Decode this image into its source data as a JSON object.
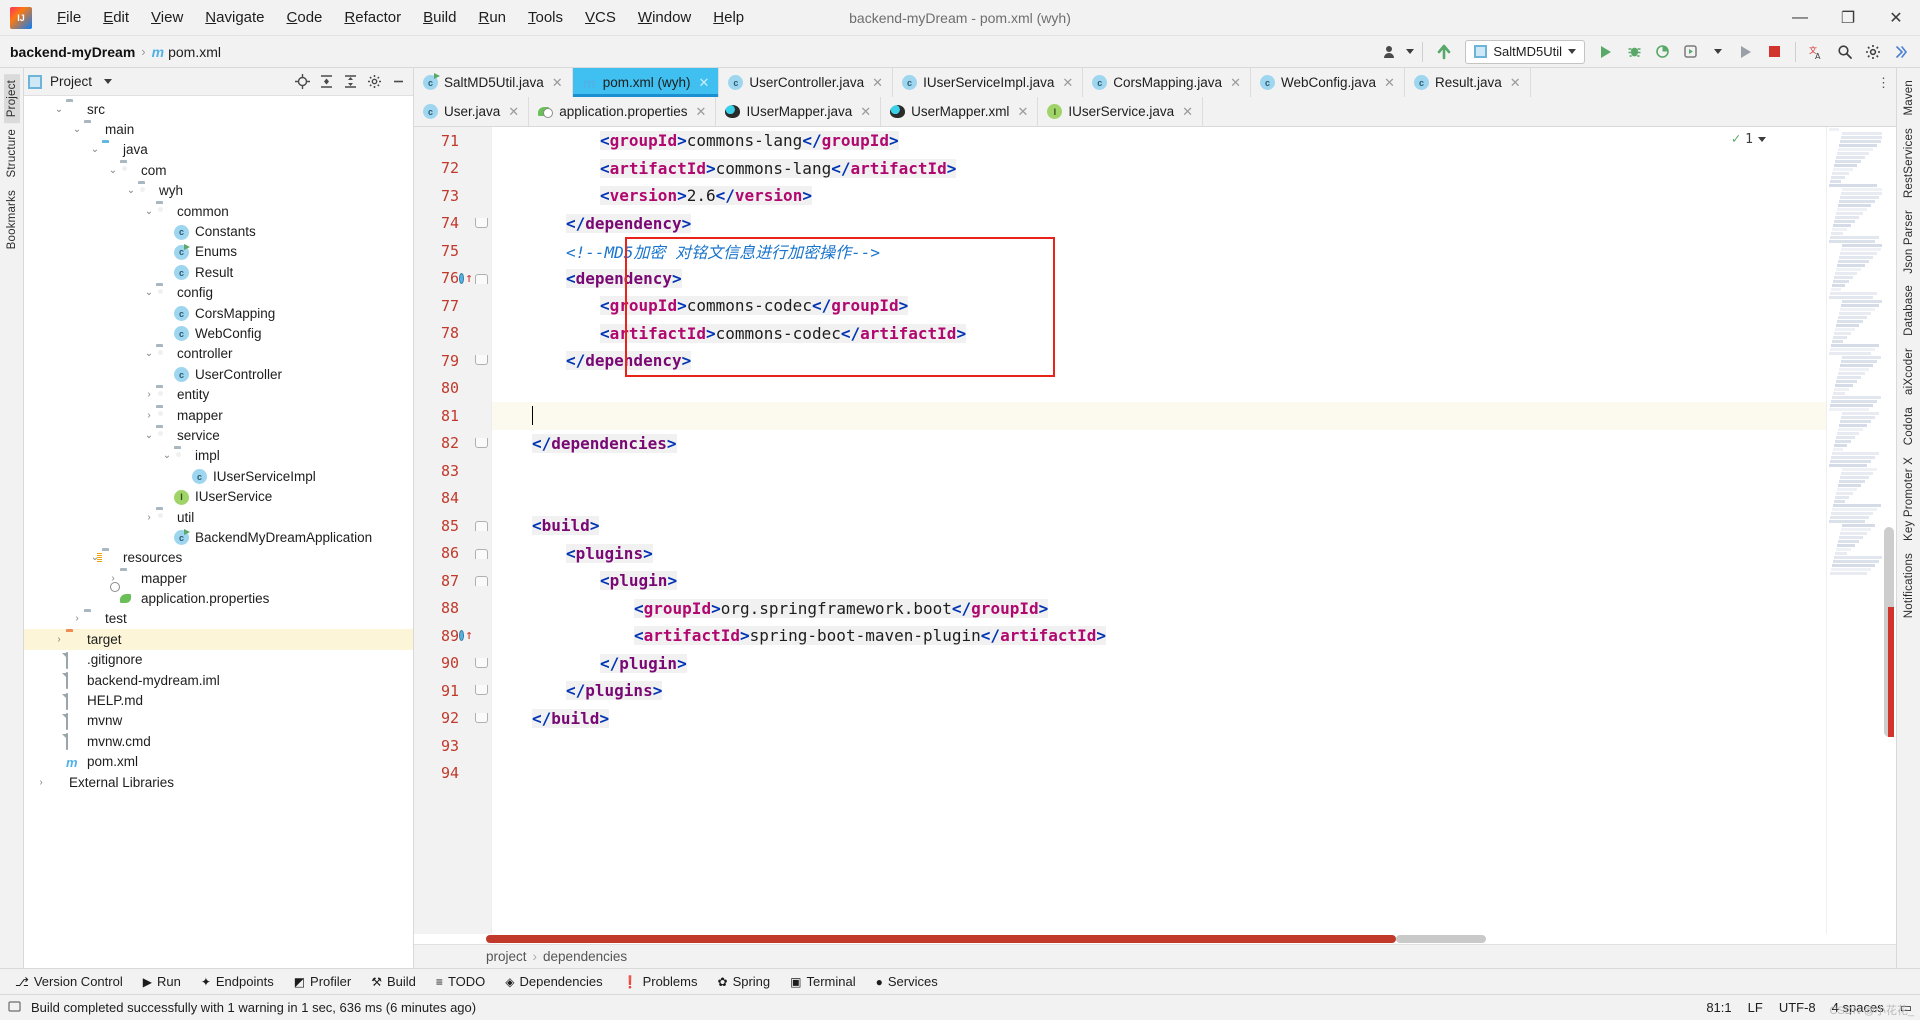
{
  "window": {
    "title": "backend-myDream - pom.xml (wyh)",
    "minimize": "—",
    "maximize": "❐",
    "close": "✕"
  },
  "menu": {
    "items": [
      "File",
      "Edit",
      "View",
      "Navigate",
      "Code",
      "Refactor",
      "Build",
      "Run",
      "Tools",
      "VCS",
      "Window",
      "Help"
    ]
  },
  "navbar": {
    "project": "backend-myDream",
    "separator": "›",
    "maven_icon": "m",
    "file": "pom.xml",
    "run_config": "SaltMD5Util",
    "dropdown_caret": "▼"
  },
  "left_tool_buttons": [
    {
      "label": "Project",
      "active": true
    },
    {
      "label": "Structure",
      "active": false
    },
    {
      "label": "Bookmarks",
      "active": false
    }
  ],
  "right_tool_buttons": [
    "Maven",
    "RestServices",
    "Json Parser",
    "Database",
    "aiXcoder",
    "Codota",
    "Key Promoter X",
    "Notifications"
  ],
  "project_panel": {
    "title": "Project",
    "icon": "project-icon",
    "actions": [
      "locate-icon",
      "expand-all-icon",
      "collapse-all-icon",
      "settings-icon",
      "hide-icon"
    ],
    "tree": [
      {
        "label": "src",
        "depth": 1,
        "chev": "⌄",
        "icon": "folder",
        "sel": false
      },
      {
        "label": "main",
        "depth": 2,
        "chev": "⌄",
        "icon": "folder",
        "sel": false
      },
      {
        "label": "java",
        "depth": 3,
        "chev": "⌄",
        "icon": "folder-blue",
        "sel": false
      },
      {
        "label": "com",
        "depth": 4,
        "chev": "⌄",
        "icon": "folder-pkg",
        "sel": false
      },
      {
        "label": "wyh",
        "depth": 5,
        "chev": "⌄",
        "icon": "folder-pkg",
        "sel": false
      },
      {
        "label": "common",
        "depth": 6,
        "chev": "⌄",
        "icon": "folder-pkg",
        "sel": false
      },
      {
        "label": "Constants",
        "depth": 7,
        "chev": "",
        "icon": "class",
        "sel": false
      },
      {
        "label": "Enums",
        "depth": 7,
        "chev": "",
        "icon": "class-run",
        "sel": false
      },
      {
        "label": "Result",
        "depth": 7,
        "chev": "",
        "icon": "class",
        "sel": false
      },
      {
        "label": "config",
        "depth": 6,
        "chev": "⌄",
        "icon": "folder-pkg",
        "sel": false
      },
      {
        "label": "CorsMapping",
        "depth": 7,
        "chev": "",
        "icon": "class",
        "sel": false
      },
      {
        "label": "WebConfig",
        "depth": 7,
        "chev": "",
        "icon": "class",
        "sel": false
      },
      {
        "label": "controller",
        "depth": 6,
        "chev": "⌄",
        "icon": "folder-pkg",
        "sel": false
      },
      {
        "label": "UserController",
        "depth": 7,
        "chev": "",
        "icon": "class",
        "sel": false
      },
      {
        "label": "entity",
        "depth": 6,
        "chev": "›",
        "icon": "folder-pkg",
        "sel": false
      },
      {
        "label": "mapper",
        "depth": 6,
        "chev": "›",
        "icon": "folder-pkg",
        "sel": false
      },
      {
        "label": "service",
        "depth": 6,
        "chev": "⌄",
        "icon": "folder-pkg",
        "sel": false
      },
      {
        "label": "impl",
        "depth": 7,
        "chev": "⌄",
        "icon": "folder-pkg",
        "sel": false
      },
      {
        "label": "IUserServiceImpl",
        "depth": 8,
        "chev": "",
        "icon": "class",
        "sel": false
      },
      {
        "label": "IUserService",
        "depth": 7,
        "chev": "",
        "icon": "interface",
        "sel": false
      },
      {
        "label": "util",
        "depth": 6,
        "chev": "›",
        "icon": "folder-pkg",
        "sel": false
      },
      {
        "label": "BackendMyDreamApplication",
        "depth": 7,
        "chev": "",
        "icon": "class-run",
        "sel": false
      },
      {
        "label": "resources",
        "depth": 3,
        "chev": "⌄",
        "icon": "folder-res",
        "sel": false
      },
      {
        "label": "mapper",
        "depth": 4,
        "chev": "›",
        "icon": "folder",
        "sel": false
      },
      {
        "label": "application.properties",
        "depth": 4,
        "chev": "",
        "icon": "properties",
        "sel": false
      },
      {
        "label": "test",
        "depth": 2,
        "chev": "›",
        "icon": "folder",
        "sel": false
      },
      {
        "label": "target",
        "depth": 1,
        "chev": "›",
        "icon": "folder-orange",
        "sel": true
      },
      {
        "label": ".gitignore",
        "depth": 1,
        "chev": "",
        "icon": "file",
        "sel": false
      },
      {
        "label": "backend-mydream.iml",
        "depth": 1,
        "chev": "",
        "icon": "file",
        "sel": false
      },
      {
        "label": "HELP.md",
        "depth": 1,
        "chev": "",
        "icon": "file",
        "sel": false
      },
      {
        "label": "mvnw",
        "depth": 1,
        "chev": "",
        "icon": "file",
        "sel": false
      },
      {
        "label": "mvnw.cmd",
        "depth": 1,
        "chev": "",
        "icon": "file",
        "sel": false
      },
      {
        "label": "pom.xml",
        "depth": 1,
        "chev": "",
        "icon": "maven",
        "sel": false
      },
      {
        "label": "External Libraries",
        "depth": 0,
        "chev": "›",
        "icon": "library",
        "sel": false
      }
    ]
  },
  "editor": {
    "tabs_row1": [
      {
        "label": "SaltMD5Util.java",
        "icon": "class-run",
        "active": false,
        "close": "✕"
      },
      {
        "label": "pom.xml (wyh)",
        "icon": "maven",
        "active": true,
        "close": "✕"
      },
      {
        "label": "UserController.java",
        "icon": "class",
        "active": false,
        "close": "✕"
      },
      {
        "label": "IUserServiceImpl.java",
        "icon": "class",
        "active": false,
        "close": "✕"
      },
      {
        "label": "CorsMapping.java",
        "icon": "class",
        "active": false,
        "close": "✕"
      },
      {
        "label": "WebConfig.java",
        "icon": "class",
        "active": false,
        "close": "✕"
      },
      {
        "label": "Result.java",
        "icon": "class",
        "active": false,
        "close": "✕"
      }
    ],
    "tabs_row2": [
      {
        "label": "User.java",
        "icon": "class",
        "active": false,
        "close": "✕"
      },
      {
        "label": "application.properties",
        "icon": "properties",
        "active": false,
        "close": "✕"
      },
      {
        "label": "IUserMapper.java",
        "icon": "mybatis",
        "active": false,
        "close": "✕"
      },
      {
        "label": "UserMapper.xml",
        "icon": "mybatis",
        "active": false,
        "close": "✕"
      },
      {
        "label": "IUserService.java",
        "icon": "interface",
        "active": false,
        "close": "✕"
      }
    ],
    "tabs_overflow": "⋮",
    "inspection_count": "1",
    "inspection_check": "✓",
    "breadcrumbs": [
      "project",
      "dependencies"
    ],
    "breadcrumb_sep": "›",
    "lines": [
      {
        "num": "71",
        "indent": 6,
        "fold": "",
        "mark": "",
        "parts": [
          [
            "br",
            "<"
          ],
          [
            "tag",
            "groupId"
          ],
          [
            "br",
            ">"
          ],
          [
            "txt",
            "commons-lang"
          ],
          [
            "br",
            "</"
          ],
          [
            "tag",
            "groupId"
          ],
          [
            "br",
            ">"
          ]
        ]
      },
      {
        "num": "72",
        "indent": 6,
        "fold": "",
        "mark": "",
        "parts": [
          [
            "br",
            "<"
          ],
          [
            "tag",
            "artifactId"
          ],
          [
            "br",
            ">"
          ],
          [
            "txt",
            "commons-lang"
          ],
          [
            "br",
            "</"
          ],
          [
            "tag",
            "artifactId"
          ],
          [
            "br",
            ">"
          ]
        ]
      },
      {
        "num": "73",
        "indent": 6,
        "fold": "",
        "mark": "",
        "parts": [
          [
            "br",
            "<"
          ],
          [
            "tag",
            "version"
          ],
          [
            "br",
            ">"
          ],
          [
            "txt",
            "2.6"
          ],
          [
            "br",
            "</"
          ],
          [
            "tag",
            "version"
          ],
          [
            "br",
            ">"
          ]
        ]
      },
      {
        "num": "74",
        "indent": 4,
        "fold": "close",
        "mark": "",
        "parts": [
          [
            "br",
            "</"
          ],
          [
            "cls",
            "dependency"
          ],
          [
            "br",
            ">"
          ]
        ]
      },
      {
        "num": "75",
        "indent": 4,
        "fold": "",
        "mark": "",
        "parts": [
          [
            "cmt",
            "<!--MD5加密 对铭文信息进行加密操作-->"
          ]
        ]
      },
      {
        "num": "76",
        "indent": 4,
        "fold": "open",
        "mark": "bookmark-arrow",
        "parts": [
          [
            "br",
            "<"
          ],
          [
            "cls",
            "dependency"
          ],
          [
            "br",
            ">"
          ]
        ]
      },
      {
        "num": "77",
        "indent": 6,
        "fold": "",
        "mark": "",
        "parts": [
          [
            "br",
            "<"
          ],
          [
            "tag",
            "groupId"
          ],
          [
            "br",
            ">"
          ],
          [
            "txt",
            "commons-codec"
          ],
          [
            "br",
            "</"
          ],
          [
            "tag",
            "groupId"
          ],
          [
            "br",
            ">"
          ]
        ]
      },
      {
        "num": "78",
        "indent": 6,
        "fold": "",
        "mark": "",
        "parts": [
          [
            "br",
            "<"
          ],
          [
            "tag",
            "artifactId"
          ],
          [
            "br",
            ">"
          ],
          [
            "txt",
            "commons-codec"
          ],
          [
            "br",
            "</"
          ],
          [
            "tag",
            "artifactId"
          ],
          [
            "br",
            ">"
          ]
        ]
      },
      {
        "num": "79",
        "indent": 4,
        "fold": "close",
        "mark": "",
        "parts": [
          [
            "br",
            "</"
          ],
          [
            "cls",
            "dependency"
          ],
          [
            "br",
            ">"
          ]
        ]
      },
      {
        "num": "80",
        "indent": 0,
        "fold": "",
        "mark": "",
        "parts": []
      },
      {
        "num": "81",
        "indent": 2,
        "fold": "",
        "mark": "",
        "caret": true,
        "hl": true,
        "parts": []
      },
      {
        "num": "82",
        "indent": 2,
        "fold": "close",
        "mark": "",
        "parts": [
          [
            "br",
            "</"
          ],
          [
            "cls",
            "dependencies"
          ],
          [
            "br",
            ">"
          ]
        ]
      },
      {
        "num": "83",
        "indent": 0,
        "fold": "",
        "mark": "",
        "parts": []
      },
      {
        "num": "84",
        "indent": 0,
        "fold": "",
        "mark": "",
        "parts": []
      },
      {
        "num": "85",
        "indent": 2,
        "fold": "open",
        "mark": "",
        "parts": [
          [
            "br",
            "<"
          ],
          [
            "cls",
            "build"
          ],
          [
            "br",
            ">"
          ]
        ]
      },
      {
        "num": "86",
        "indent": 4,
        "fold": "open",
        "mark": "",
        "parts": [
          [
            "br",
            "<"
          ],
          [
            "cls",
            "plugins"
          ],
          [
            "br",
            ">"
          ]
        ]
      },
      {
        "num": "87",
        "indent": 6,
        "fold": "open",
        "mark": "",
        "parts": [
          [
            "br",
            "<"
          ],
          [
            "cls",
            "plugin"
          ],
          [
            "br",
            ">"
          ]
        ]
      },
      {
        "num": "88",
        "indent": 8,
        "fold": "",
        "mark": "",
        "parts": [
          [
            "br",
            "<"
          ],
          [
            "tag",
            "groupId"
          ],
          [
            "br",
            ">"
          ],
          [
            "txt",
            "org.springframework.boot"
          ],
          [
            "br",
            "</"
          ],
          [
            "tag",
            "groupId"
          ],
          [
            "br",
            ">"
          ]
        ]
      },
      {
        "num": "89",
        "indent": 8,
        "fold": "",
        "mark": "bookmark-arrow",
        "parts": [
          [
            "br",
            "<"
          ],
          [
            "tag",
            "artifactId"
          ],
          [
            "br",
            ">"
          ],
          [
            "txt",
            "spring-boot-maven-plugin"
          ],
          [
            "br",
            "</"
          ],
          [
            "tag",
            "artifactId"
          ],
          [
            "br",
            ">"
          ]
        ]
      },
      {
        "num": "90",
        "indent": 6,
        "fold": "close",
        "mark": "",
        "parts": [
          [
            "br",
            "</"
          ],
          [
            "cls",
            "plugin"
          ],
          [
            "br",
            ">"
          ]
        ]
      },
      {
        "num": "91",
        "indent": 4,
        "fold": "close",
        "mark": "",
        "parts": [
          [
            "br",
            "</"
          ],
          [
            "cls",
            "plugins"
          ],
          [
            "br",
            ">"
          ]
        ]
      },
      {
        "num": "92",
        "indent": 2,
        "fold": "close",
        "mark": "",
        "parts": [
          [
            "br",
            "</"
          ],
          [
            "cls",
            "build"
          ],
          [
            "br",
            ">"
          ]
        ]
      },
      {
        "num": "93",
        "indent": 0,
        "fold": "",
        "mark": "",
        "parts": []
      },
      {
        "num": "94",
        "indent": 0,
        "fold": "",
        "mark": "",
        "parts": []
      }
    ]
  },
  "tool_windows": [
    {
      "label": "Version Control",
      "icon": "⎇"
    },
    {
      "label": "Run",
      "icon": "▶"
    },
    {
      "label": "Endpoints",
      "icon": "✦"
    },
    {
      "label": "Profiler",
      "icon": "◩"
    },
    {
      "label": "Build",
      "icon": "⚒"
    },
    {
      "label": "TODO",
      "icon": "≡"
    },
    {
      "label": "Dependencies",
      "icon": "◈"
    },
    {
      "label": "Problems",
      "icon": "❗"
    },
    {
      "label": "Spring",
      "icon": "✿"
    },
    {
      "label": "Terminal",
      "icon": "▣"
    },
    {
      "label": "Services",
      "icon": "●"
    }
  ],
  "statusbar": {
    "message": "Build completed successfully with 1 warning in 1 sec, 636 ms (6 minutes ago)",
    "caret_pos": "81:1",
    "line_sep": "LF",
    "encoding": "UTF-8",
    "indent": "4 spaces",
    "lock_icon": "▭",
    "watermark": "CSDN @小花花_"
  },
  "colors": {
    "accent_tab": "#3fc0f0",
    "tab_underline": "#1a8fd1",
    "line_number": "#c0392b",
    "comment": "#1874cd",
    "tag": "#b0086e",
    "bracket": "#0033b3",
    "selection_row": "#fdf5d8",
    "error_red": "#e8241a",
    "run_green": "#59a869"
  }
}
